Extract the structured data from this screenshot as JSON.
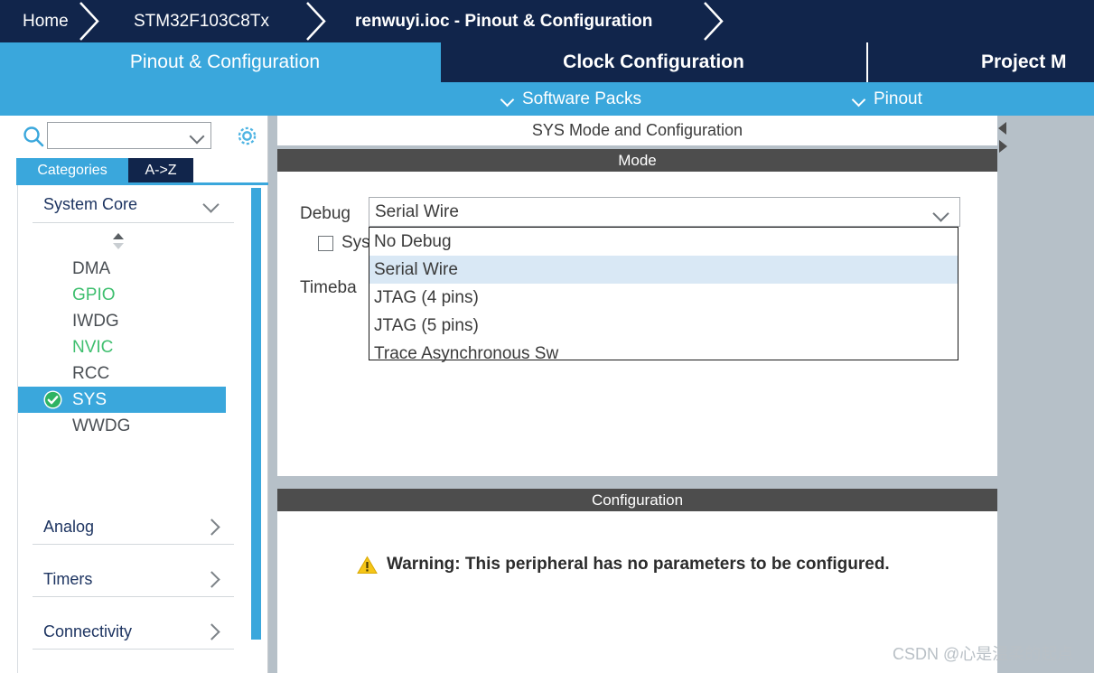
{
  "breadcrumb": {
    "items": [
      {
        "label": "Home",
        "bold": false
      },
      {
        "label": "STM32F103C8Tx",
        "bold": false
      },
      {
        "label": "renwuyi.ioc - Pinout & Configuration",
        "bold": true
      }
    ]
  },
  "tabs": [
    {
      "label": "Pinout & Configuration",
      "active": true
    },
    {
      "label": "Clock Configuration",
      "active": false
    },
    {
      "label": "Project M",
      "active": false
    }
  ],
  "subbar": {
    "menus": [
      {
        "label": "Software Packs",
        "icon": "chevron-down-icon"
      },
      {
        "label": "Pinout",
        "icon": "chevron-down-icon"
      }
    ]
  },
  "sidebar": {
    "search": {
      "placeholder": "",
      "value": "",
      "icon": "search-icon",
      "chevron": "chevron-down-icon"
    },
    "settings_icon": "gear-icon",
    "category_tabs": [
      {
        "label": "Categories",
        "active": true
      },
      {
        "label": "A->Z",
        "active": false
      }
    ],
    "groups": [
      {
        "title": "System Core",
        "expanded": true,
        "chevron": "chevron-down-icon",
        "items": [
          {
            "label": "DMA",
            "state": "default"
          },
          {
            "label": "GPIO",
            "state": "configured"
          },
          {
            "label": "IWDG",
            "state": "default"
          },
          {
            "label": "NVIC",
            "state": "configured"
          },
          {
            "label": "RCC",
            "state": "default"
          },
          {
            "label": "SYS",
            "state": "selected",
            "icon": "check-circle-icon"
          },
          {
            "label": "WWDG",
            "state": "default"
          }
        ]
      },
      {
        "title": "Analog",
        "expanded": false,
        "chevron": "chevron-right-icon",
        "items": []
      },
      {
        "title": "Timers",
        "expanded": false,
        "chevron": "chevron-right-icon",
        "items": []
      },
      {
        "title": "Connectivity",
        "expanded": false,
        "chevron": "chevron-right-icon",
        "items": []
      }
    ]
  },
  "main": {
    "panel_title": "SYS Mode and Configuration",
    "mode_section": {
      "header": "Mode",
      "debug_label": "Debug",
      "debug_value": "Serial Wire",
      "debug_chevron": "chevron-down-icon",
      "checkbox_label": "Sys",
      "checkbox_checked": false,
      "timebase_label": "Timeba",
      "dropdown": {
        "open": true,
        "options": [
          {
            "label": "No Debug",
            "selected": false
          },
          {
            "label": "Serial Wire",
            "selected": true
          },
          {
            "label": "JTAG (4 pins)",
            "selected": false
          },
          {
            "label": "JTAG (5 pins)",
            "selected": false
          },
          {
            "label": "Trace Asynchronous Sw",
            "selected": false
          }
        ]
      }
    },
    "configuration_section": {
      "header": "Configuration",
      "warning_icon": "warning-triangle-icon",
      "warning_text": "Warning: This peripheral has no parameters to be configured."
    }
  },
  "splitter": {
    "collapse_left_icon": "triangle-left-icon",
    "expand_right_icon": "triangle-right-icon"
  },
  "watermark": "CSDN @心是温柔的起点",
  "colors": {
    "navy": "#11254b",
    "accent_blue": "#3aa7dc",
    "section_gray": "#4d4d4d",
    "green": "#3fbf6f",
    "warning_yellow": "#f5c518",
    "highlight": "#d9e8f5"
  }
}
